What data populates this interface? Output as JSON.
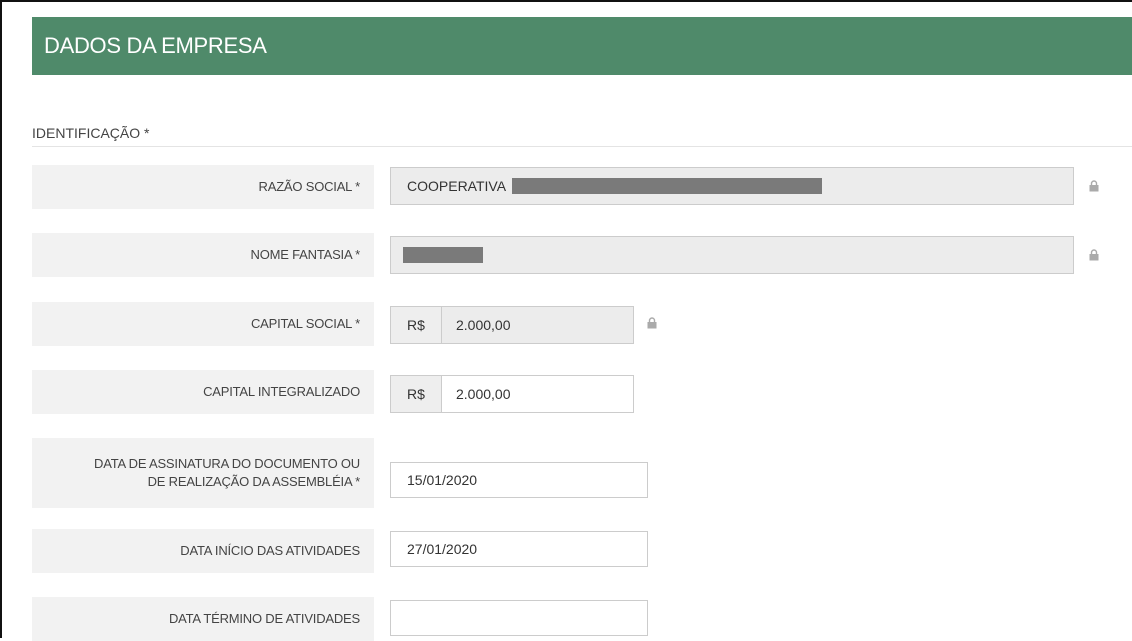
{
  "header": {
    "title": "DADOS DA EMPRESA"
  },
  "section": {
    "title": "IDENTIFICAÇÃO *"
  },
  "fields": {
    "razao_social": {
      "label": "RAZÃO SOCIAL *",
      "value": "COOPERATIVA"
    },
    "nome_fantasia": {
      "label": "NOME FANTASIA *",
      "value": ""
    },
    "capital_social": {
      "label": "CAPITAL SOCIAL *",
      "currency": "R$",
      "value": "2.000,00"
    },
    "capital_integralizado": {
      "label": "CAPITAL INTEGRALIZADO",
      "currency": "R$",
      "value": "2.000,00"
    },
    "data_assinatura": {
      "label_line1": "DATA DE ASSINATURA DO DOCUMENTO OU",
      "label_line2": "DE REALIZAÇÃO DA ASSEMBLÉIA *",
      "value": "15/01/2020"
    },
    "data_inicio": {
      "label": "DATA INÍCIO DAS ATIVIDADES",
      "value": "27/01/2020"
    },
    "data_termino": {
      "label": "DATA TÉRMINO DE ATIVIDADES",
      "value": ""
    }
  },
  "icons": {
    "lock": "lock-icon"
  },
  "colors": {
    "header_bg": "#4f8a6a",
    "label_bg": "#f2f2f2",
    "readonly_bg": "#ececec",
    "lock": "#aaaaaa"
  }
}
